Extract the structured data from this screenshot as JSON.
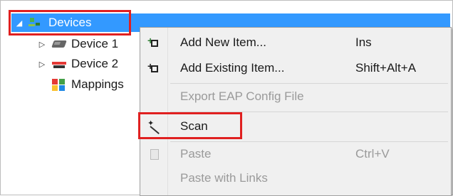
{
  "tree": {
    "nodes": [
      {
        "label": "Devices",
        "expanded": true,
        "selected": true,
        "icon": "devices-icon"
      },
      {
        "label": "Device 1",
        "expanded": false,
        "icon": "device-icon"
      },
      {
        "label": "Device 2",
        "expanded": false,
        "icon": "device-icon"
      },
      {
        "label": "Mappings",
        "icon": "mappings-icon"
      }
    ]
  },
  "context_menu": {
    "items": [
      {
        "label": "Add New Item...",
        "shortcut": "Ins",
        "enabled": true,
        "icon": "add-new-item-icon"
      },
      {
        "label": "Add Existing Item...",
        "shortcut": "Shift+Alt+A",
        "enabled": true,
        "icon": "add-existing-item-icon"
      },
      {
        "label": "Export EAP Config File",
        "shortcut": "",
        "enabled": false
      },
      {
        "label": "Scan",
        "shortcut": "",
        "enabled": true,
        "icon": "magic-wand-icon",
        "highlighted": true
      },
      {
        "label": "Paste",
        "shortcut": "Ctrl+V",
        "enabled": false,
        "icon": "paste-icon"
      },
      {
        "label": "Paste with Links",
        "shortcut": "",
        "enabled": false
      }
    ]
  },
  "colors": {
    "selection": "#3399ff",
    "highlight_box": "#e02020"
  }
}
